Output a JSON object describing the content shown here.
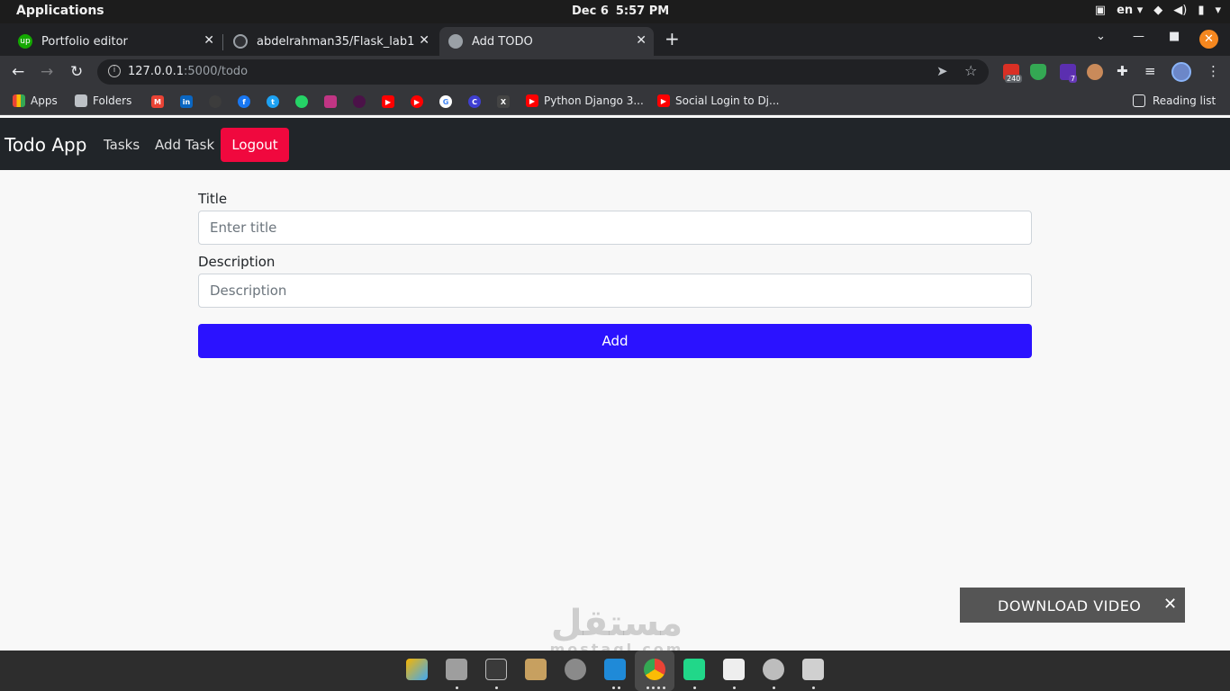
{
  "system": {
    "apps_label": "Applications",
    "date": "Dec 6",
    "time": "5:57 PM",
    "lang": "en"
  },
  "tabs": [
    {
      "title": "Portfolio editor",
      "icon": "upwork-icon",
      "active": false
    },
    {
      "title": "abdelrahman35/Flask_lab1",
      "icon": "github-icon",
      "active": false
    },
    {
      "title": "Add TODO",
      "icon": "globe-icon",
      "active": true
    }
  ],
  "address": {
    "host": "127.0.0.1",
    "path": ":5000/todo"
  },
  "extensions": {
    "gmail_badge": "240",
    "ext_badge": "7"
  },
  "bookmarks": {
    "apps": "Apps",
    "folders": "Folders",
    "item1": "Python Django 3...",
    "item2": "Social Login to Dj...",
    "reading_list": "Reading list"
  },
  "app": {
    "brand": "Todo App",
    "nav": {
      "tasks": "Tasks",
      "add_task": "Add Task",
      "logout": "Logout"
    },
    "form": {
      "title_label": "Title",
      "title_placeholder": "Enter title",
      "title_value": "",
      "description_label": "Description",
      "description_placeholder": "Description",
      "description_value": "",
      "submit_label": "Add"
    }
  },
  "overlay": {
    "download_label": "DOWNLOAD VIDEO"
  },
  "watermark": {
    "arabic": "مستقل",
    "latin": "mostaql.com"
  },
  "colors": {
    "navbar_bg": "#212529",
    "logout_bg": "#f0083e",
    "add_button_bg": "#2b12ff",
    "page_bg": "#f8f8f8"
  }
}
